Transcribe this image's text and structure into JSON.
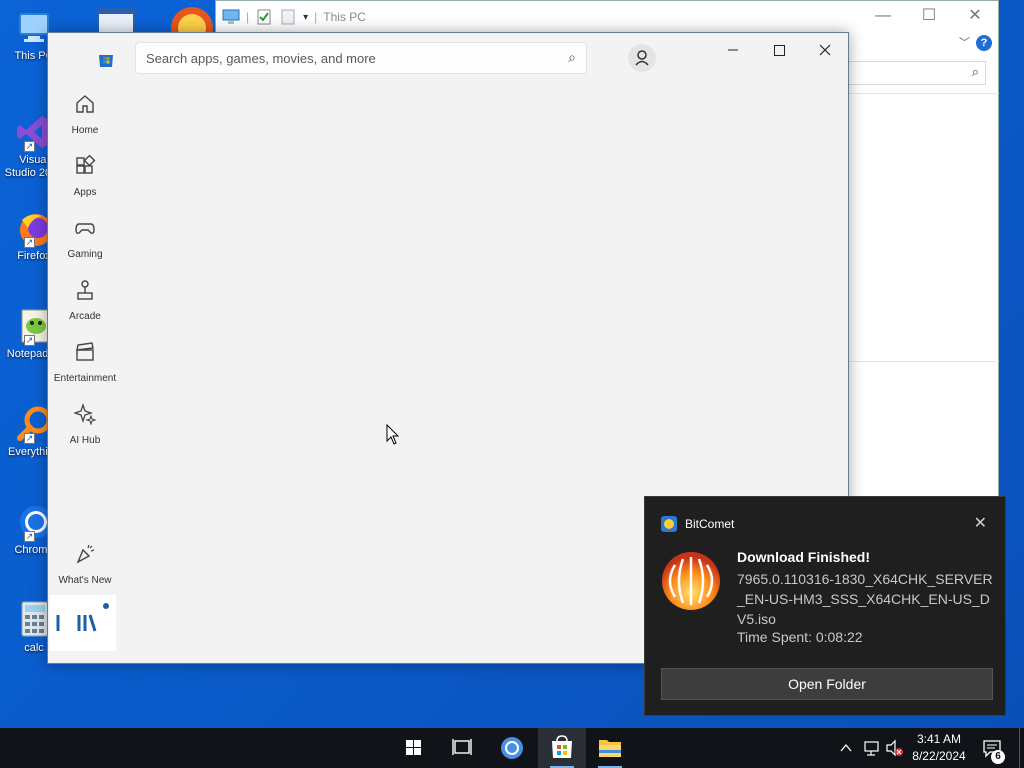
{
  "desktop": {
    "icons": [
      {
        "label": "This PC",
        "icon": "this-pc-icon"
      },
      {
        "label": "Visual Studio 2017",
        "icon": "visual-studio-icon"
      },
      {
        "label": "Firefox",
        "icon": "firefox-icon"
      },
      {
        "label": "Notepad++",
        "icon": "notepad-plus-plus-icon"
      },
      {
        "label": "Everything",
        "icon": "everything-search-icon"
      },
      {
        "label": "Chrome",
        "icon": "chrome-icon"
      },
      {
        "label": "calc",
        "icon": "calculator-icon"
      }
    ]
  },
  "explorer": {
    "title": "This PC",
    "minimize": "—",
    "maximize": "☐",
    "close": "✕",
    "help": "?"
  },
  "store": {
    "search_placeholder": "Search apps, games, movies, and more",
    "nav": [
      {
        "label": "Home",
        "icon": "home-icon"
      },
      {
        "label": "Apps",
        "icon": "apps-icon"
      },
      {
        "label": "Gaming",
        "icon": "gamepad-icon"
      },
      {
        "label": "Arcade",
        "icon": "joystick-icon"
      },
      {
        "label": "Entertainment",
        "icon": "clapperboard-icon"
      },
      {
        "label": "AI Hub",
        "icon": "sparkle-icon"
      }
    ],
    "whats_new": "What's New",
    "library_icon": "library-icon"
  },
  "toast": {
    "app_name": "BitComet",
    "headline": "Download Finished!",
    "file_name": "7965.0.110316-1830_X64CHK_SERVER_EN-US-HM3_SSS_X64CHK_EN-US_DV5.iso",
    "time_spent": "Time Spent: 0:08:22",
    "button": "Open Folder",
    "close": "✕"
  },
  "taskbar": {
    "apps": [
      "start-icon",
      "task-view-icon",
      "chrome-icon",
      "store-icon",
      "file-explorer-icon"
    ],
    "active_app": "store-icon",
    "time": "3:41 AM",
    "date": "8/22/2024",
    "notification_count": "6"
  },
  "colors": {
    "wallpaper": "#0a5ccc",
    "taskbar": "#101418",
    "accent": "#2a78d2",
    "toast_bg": "#1f1f1f"
  }
}
